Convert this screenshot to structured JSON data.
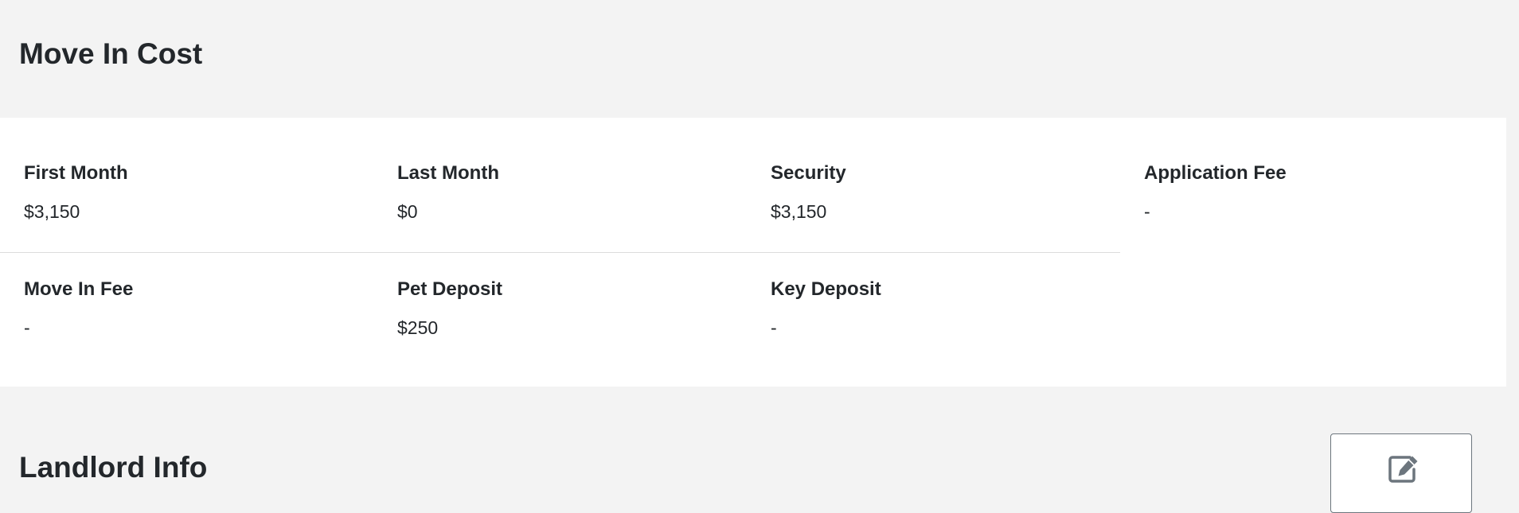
{
  "move_in_cost": {
    "title": "Move In Cost",
    "items": [
      {
        "label": "First Month",
        "value": "$3,150"
      },
      {
        "label": "Last Month",
        "value": "$0"
      },
      {
        "label": "Security",
        "value": "$3,150"
      },
      {
        "label": "Application Fee",
        "value": "-"
      },
      {
        "label": "Move In Fee",
        "value": "-"
      },
      {
        "label": "Pet Deposit",
        "value": "$250"
      },
      {
        "label": "Key Deposit",
        "value": "-"
      }
    ]
  },
  "landlord_info": {
    "title": "Landlord Info",
    "edit_icon": "edit-icon"
  },
  "colors": {
    "page_background": "#f3f3f3",
    "card_background": "#ffffff",
    "text": "#23272b",
    "icon": "#6c757d"
  }
}
